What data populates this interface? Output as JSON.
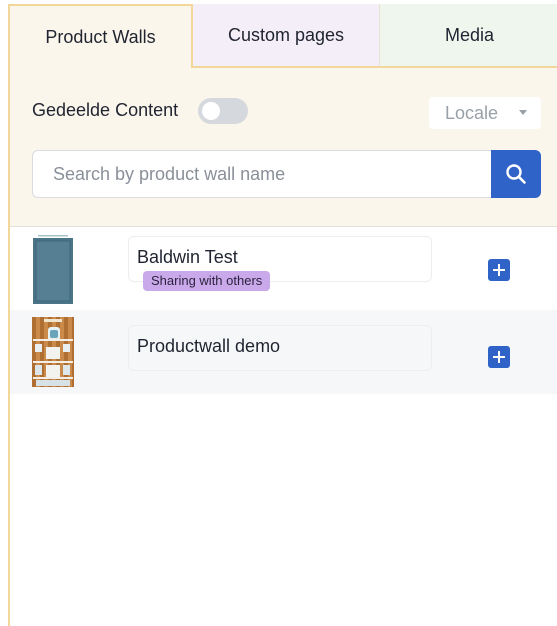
{
  "tabs": [
    {
      "label": "Product Walls"
    },
    {
      "label": "Custom pages"
    },
    {
      "label": "Media"
    }
  ],
  "filters": {
    "shared_toggle_label": "Gedeelde Content",
    "shared_toggle_on": false,
    "locale_label": "Locale"
  },
  "search": {
    "placeholder": "Search by product wall name"
  },
  "items": [
    {
      "name": "Baldwin Test",
      "badge": "Sharing with others",
      "thumbnail_icon": "product-wall-thumbnail"
    },
    {
      "name": "Productwall demo",
      "badge": "",
      "thumbnail_icon": "product-wall-thumbnail"
    }
  ],
  "colors": {
    "accent": "#2f63c8",
    "tab_border": "#f3d79a",
    "badge": "#c9a9ea"
  }
}
